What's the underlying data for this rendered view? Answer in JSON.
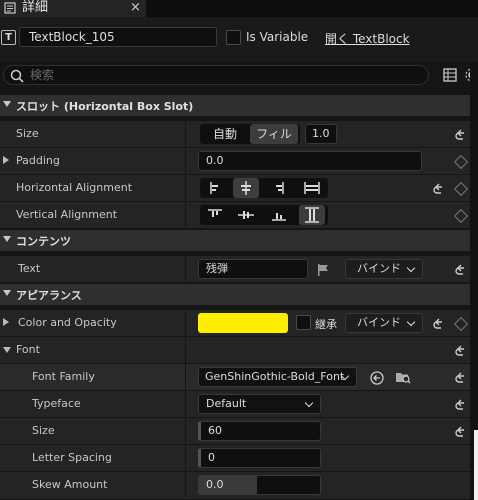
{
  "tab": {
    "title": "詳細",
    "close": "×"
  },
  "header": {
    "badge": "T",
    "name": "TextBlock_105",
    "is_variable_label": "Is Variable",
    "open_link": "開く TextBlock"
  },
  "search": {
    "placeholder": "検索"
  },
  "sections": {
    "slot": "スロット (Horizontal Box Slot)",
    "content": "コンテンツ",
    "appearance": "アピアランス"
  },
  "rows": {
    "size": {
      "label": "Size",
      "auto": "自動",
      "fill": "フィル",
      "value": "1.0"
    },
    "padding": {
      "label": "Padding",
      "value": "0.0"
    },
    "halign": {
      "label": "Horizontal Alignment"
    },
    "valign": {
      "label": "Vertical Alignment"
    },
    "text": {
      "label": "Text",
      "value": "残弾",
      "bind": "バインド"
    },
    "color": {
      "label": "Color and Opacity",
      "inherit": "継承",
      "bind": "バインド",
      "swatch": "#ffee00"
    },
    "font": {
      "label": "Font"
    },
    "font_family": {
      "label": "Font Family",
      "value": "GenShinGothic-Bold_Font"
    },
    "typeface": {
      "label": "Typeface",
      "value": "Default"
    },
    "font_size": {
      "label": "Size",
      "value": "60"
    },
    "letter_spacing": {
      "label": "Letter Spacing",
      "value": "0"
    },
    "skew": {
      "label": "Skew Amount",
      "value": "0.0"
    }
  }
}
